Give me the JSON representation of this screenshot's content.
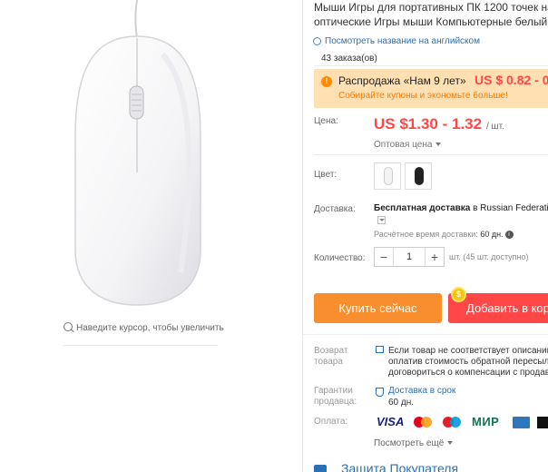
{
  "product": {
    "title_line1": "Мыши Игры для портативных ПК 1200 точек на",
    "title_line2": "оптические Игры мыши Компьютерные белый"
  },
  "translate_link": "Посмотреть название на английском",
  "orders": "43 заказа(ов)",
  "promo": {
    "title": "Распродажа «Нам 9 лет»",
    "price": "US $ 0.82 - 0",
    "subtitle": "Собирайте купоны и экономьте больше!"
  },
  "price": {
    "label": "Цена:",
    "value": "US $1.30 - 1.32",
    "unit": "/ шт.",
    "wholesale": "Оптовая цена"
  },
  "color": {
    "label": "Цвет:",
    "options": [
      "white",
      "black"
    ],
    "selected": "white"
  },
  "shipping": {
    "label": "Доставка:",
    "free": "Бесплатная доставка",
    "to": "в Russian Federatio",
    "estimate_label": "Расчётное время доставки:",
    "estimate_days": "60 дн."
  },
  "quantity": {
    "label": "Количество:",
    "value": "1",
    "minus": "−",
    "plus": "+",
    "stock": "шт. (45 шт. доступно)"
  },
  "buttons": {
    "buy": "Купить сейчас",
    "cart": "Добавить в кор"
  },
  "returns": {
    "label_l1": "Возврат",
    "label_l2": "товара",
    "text_l1": "Если товар не соответствует описанию,",
    "text_l2": "оплатив стоимость обратной пересылк",
    "text_l3": "договориться о компенсации с продав"
  },
  "guarantee": {
    "label_l1": "Гарантии",
    "label_l2": "продавца:",
    "text": "Доставка в срок",
    "days": "60 дн."
  },
  "payment": {
    "label": "Оплата:",
    "visa": "VISA",
    "mir": "МИР",
    "see_more": "Посмотреть ещё"
  },
  "protection": "Защита Покупателя",
  "zoom_hint": "Наведите курсор, чтобы увеличить",
  "colors": {
    "accent_orange": "#f98e2f",
    "accent_red": "#ff4747",
    "link_blue": "#2b6fb6",
    "promo_bg": "#ffe0b2"
  }
}
